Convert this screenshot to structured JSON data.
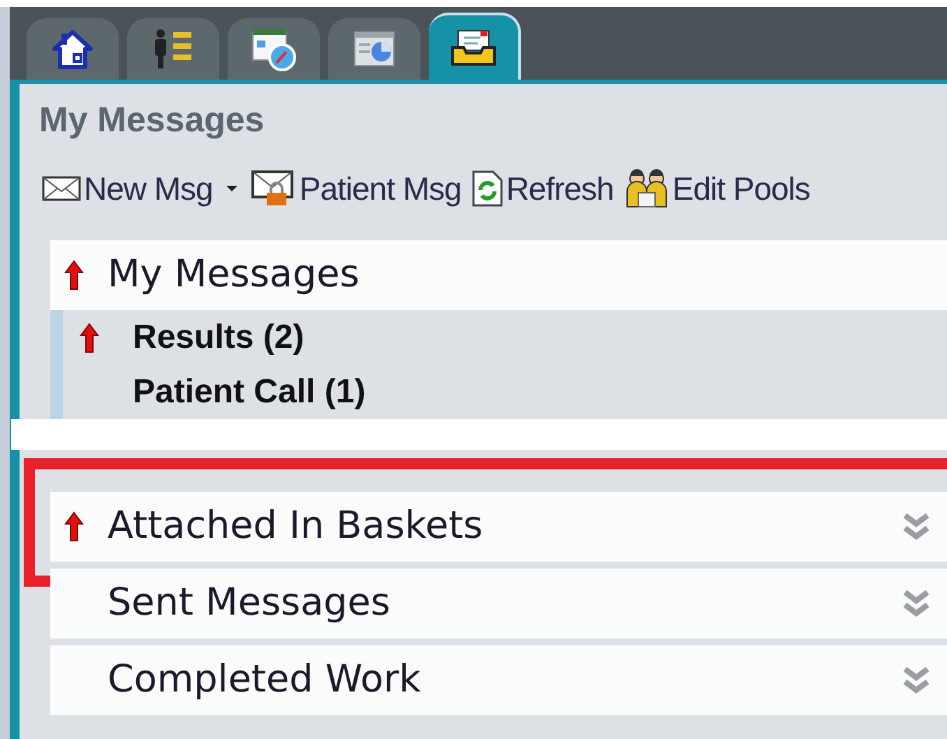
{
  "tabs": [
    {
      "kind": "home",
      "selected": false
    },
    {
      "kind": "people",
      "selected": false
    },
    {
      "kind": "schedule",
      "selected": false
    },
    {
      "kind": "chart",
      "selected": false
    },
    {
      "kind": "inbox",
      "selected": true
    }
  ],
  "title": "My Messages",
  "toolbar": [
    {
      "kind": "new",
      "label": "New Msg",
      "dropdown": true
    },
    {
      "kind": "patient",
      "label": "Patient Msg",
      "dropdown": false
    },
    {
      "kind": "refresh",
      "label": "Refresh",
      "dropdown": false
    },
    {
      "kind": "pools",
      "label": "Edit Pools",
      "dropdown": false
    }
  ],
  "sections": [
    {
      "label": "My Messages",
      "flagged": true,
      "expanded": true,
      "children": [
        {
          "label": "Results (2)",
          "flagged": true
        },
        {
          "label": "Patient Call (1)",
          "flagged": false
        }
      ]
    },
    {
      "label": "Attached In Baskets",
      "flagged": true,
      "expanded": false,
      "highlighted": true
    },
    {
      "label": "Sent Messages",
      "flagged": false,
      "expanded": false,
      "highlighted": false
    },
    {
      "label": "Completed Work",
      "flagged": false,
      "expanded": false,
      "highlighted": false
    }
  ]
}
